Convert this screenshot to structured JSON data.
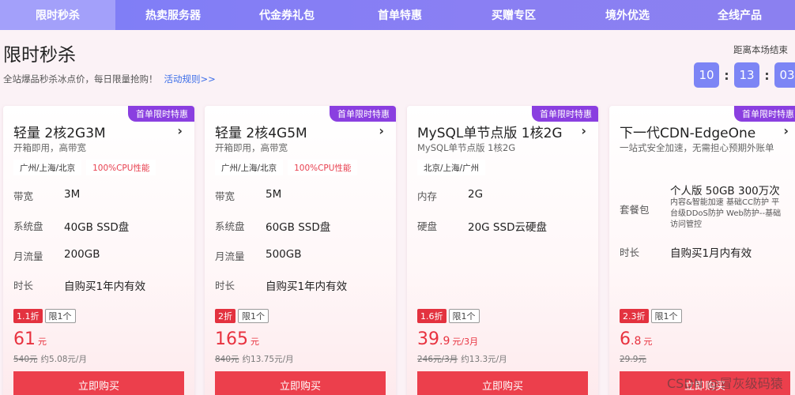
{
  "nav": {
    "items": [
      {
        "label": "限时秒杀",
        "active": true
      },
      {
        "label": "热卖服务器"
      },
      {
        "label": "代金券礼包"
      },
      {
        "label": "首单特惠"
      },
      {
        "label": "买赠专区"
      },
      {
        "label": "境外优选"
      },
      {
        "label": "全线产品"
      }
    ]
  },
  "header": {
    "title": "限时秒杀",
    "subtitle": "全站爆品秒杀冰点价，每日限量抢购！",
    "rules_link": "活动规则>>",
    "countdown_label": "距离本场结束",
    "countdown": [
      "10",
      "13",
      "03"
    ]
  },
  "colors": {
    "nav_bg": "#8a7ff3",
    "badge": "#8a3fe0",
    "price_red": "#e8323f",
    "buy_button": "#ec3f4c",
    "countdown_box": "#7c85f5"
  },
  "icons": {
    "chevron": "chevron-right-icon"
  },
  "cards": [
    {
      "badge": "首单限时特惠",
      "name": "轻量 2核2G3M",
      "desc": "开箱即用，高带宽",
      "tags": [
        "广州/上海/北京",
        "100%CPU性能"
      ],
      "specs": [
        {
          "k": "带宽",
          "v": "3M"
        },
        {
          "k": "系统盘",
          "v": "40GB SSD盘"
        },
        {
          "k": "月流量",
          "v": "200GB"
        },
        {
          "k": "时长",
          "v": "自购买1年内有效"
        }
      ],
      "discount": "1.1折",
      "limit": "限1个",
      "price_int": "61",
      "price_dec": "",
      "price_unit": "元",
      "orig": "540元",
      "monthly": "约5.08元/月",
      "buy": "立即购买"
    },
    {
      "badge": "首单限时特惠",
      "name": "轻量 2核4G5M",
      "desc": "开箱即用，高带宽",
      "tags": [
        "广州/上海/北京",
        "100%CPU性能"
      ],
      "specs": [
        {
          "k": "带宽",
          "v": "5M"
        },
        {
          "k": "系统盘",
          "v": "60GB SSD盘"
        },
        {
          "k": "月流量",
          "v": "500GB"
        },
        {
          "k": "时长",
          "v": "自购买1年内有效"
        }
      ],
      "discount": "2折",
      "limit": "限1个",
      "price_int": "165",
      "price_dec": "",
      "price_unit": "元",
      "orig": "840元",
      "monthly": "约13.75元/月",
      "buy": "立即购买"
    },
    {
      "badge": "首单限时特惠",
      "name": "MySQL单节点版 1核2G",
      "desc": "MySQL单节点版 1核2G",
      "tags": [
        "北京/上海/广州"
      ],
      "specs": [
        {
          "k": "内存",
          "v": "2G"
        },
        {
          "k": "硬盘",
          "v": "20G SSD云硬盘"
        }
      ],
      "discount": "1.6折",
      "limit": "限1个",
      "price_int": "39",
      "price_dec": ".9",
      "price_unit": "元/3月",
      "orig": "246元/3月",
      "monthly": "约13.3元/月",
      "buy": "立即购买"
    },
    {
      "badge": "首单限时特惠",
      "name": "下一代CDN-EdgeOne",
      "desc": "一站式安全加速，无需担心预期外账单",
      "tags": [],
      "specs": [
        {
          "k": "套餐包",
          "v": "个人版 50GB 300万次",
          "v2": "内容&智能加速 基础CC防护 平台级DDoS防护 Web防护--基础访问管控"
        },
        {
          "k": "时长",
          "v": "自购买1月内有效"
        }
      ],
      "discount": "2.3折",
      "limit": "限1个",
      "price_int": "6",
      "price_dec": ".8",
      "price_unit": "元",
      "orig": "29.9元",
      "monthly": "",
      "buy": "立即购买"
    }
  ],
  "watermark": "CSDN @冒灰级码猿"
}
